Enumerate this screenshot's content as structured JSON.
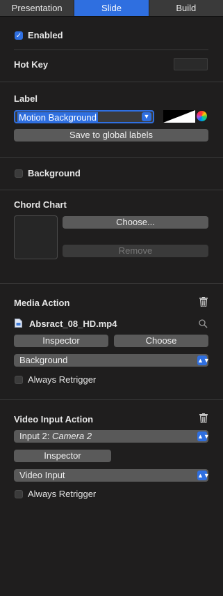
{
  "tabs": [
    "Presentation",
    "Slide",
    "Build"
  ],
  "enabled": {
    "label": "Enabled",
    "checked": true
  },
  "hotkey": {
    "label": "Hot Key"
  },
  "label_section": {
    "title": "Label",
    "value": "Motion Background",
    "save_button": "Save to global labels"
  },
  "background": {
    "label": "Background",
    "checked": false
  },
  "chord_chart": {
    "title": "Chord Chart",
    "choose_button": "Choose...",
    "remove_button": "Remove"
  },
  "media_action": {
    "title": "Media Action",
    "file_name": "Absract_08_HD.mp4",
    "inspector_button": "Inspector",
    "choose_button": "Choose",
    "layer_select": "Background",
    "retrigger_label": "Always Retrigger"
  },
  "video_input_action": {
    "title": "Video Input Action",
    "input_prefix": "Input 2: ",
    "input_camera": "Camera 2",
    "inspector_button": "Inspector",
    "layer_select": "Video Input",
    "retrigger_label": "Always Retrigger"
  },
  "colors": {
    "accent": "#2f6fe0",
    "background": "#1f1e1e"
  }
}
